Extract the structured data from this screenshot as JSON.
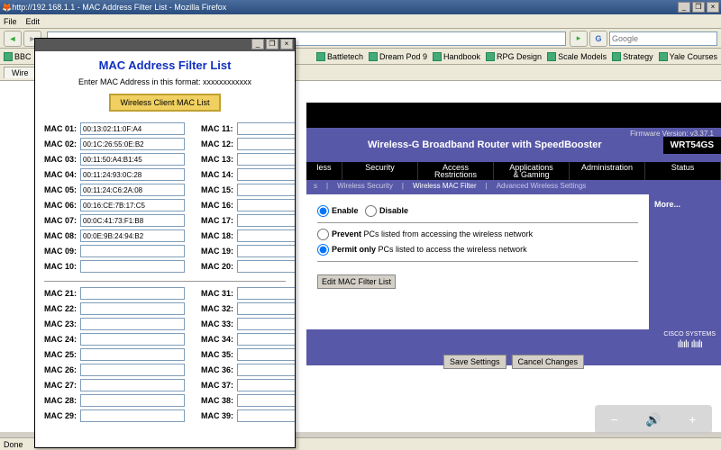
{
  "window": {
    "title": "http://192.168.1.1 - MAC Address Filter List - Mozilla Firefox"
  },
  "menu": {
    "file": "File",
    "edit": "Edit"
  },
  "search": {
    "placeholder": "Google"
  },
  "bookmarks": [
    "BBC",
    "Battletech",
    "Dream Pod 9",
    "Handbook",
    "RPG Design",
    "Scale Models",
    "Strategy",
    "Yale Courses"
  ],
  "tab": {
    "label": "Wire"
  },
  "router": {
    "fw": "Firmware Version: v3.37.1",
    "title": "Wireless-G Broadband Router with SpeedBooster",
    "model": "WRT54GS",
    "nav": {
      "less": "less",
      "security": "Security",
      "access": "Access\nRestrictions",
      "apps": "Applications\n& Gaming",
      "admin": "Administration",
      "status": "Status"
    },
    "subnav": {
      "s1": "s",
      "s2": "Wireless Security",
      "s3": "Wireless MAC Filter",
      "s4": "Advanced Wireless Settings"
    },
    "opt": {
      "enable": "Enable",
      "disable": "Disable",
      "prevent": "Prevent PCs listed from accessing the wireless network",
      "permit": "Permit only PCs listed to access the wireless network",
      "edit": "Edit MAC Filter List"
    },
    "more": "More...",
    "save": "Save Settings",
    "cancel": "Cancel Changes",
    "cisco": "CISCO SYSTEMS"
  },
  "popup": {
    "heading": "MAC Address Filter List",
    "hint": "Enter MAC Address in this format: xxxxxxxxxxxx",
    "btn": "Wireless Client MAC List",
    "left1": [
      {
        "l": "MAC 01:",
        "v": "00:13:02:11:0F:A4"
      },
      {
        "l": "MAC 02:",
        "v": "00:1C:26:55:0E:B2"
      },
      {
        "l": "MAC 03:",
        "v": "00:11:50:A4:B1:45"
      },
      {
        "l": "MAC 04:",
        "v": "00:11:24:93:0C:28"
      },
      {
        "l": "MAC 05:",
        "v": "00:11:24:C6:2A:08"
      },
      {
        "l": "MAC 06:",
        "v": "00:16:CE:7B:17:C5"
      },
      {
        "l": "MAC 07:",
        "v": "00:0C:41:73:F1:B8"
      },
      {
        "l": "MAC 08:",
        "v": "00:0E:9B:24:94:B2"
      },
      {
        "l": "MAC 09:",
        "v": ""
      },
      {
        "l": "MAC 10:",
        "v": ""
      }
    ],
    "right1": [
      {
        "l": "MAC 11:",
        "v": ""
      },
      {
        "l": "MAC 12:",
        "v": ""
      },
      {
        "l": "MAC 13:",
        "v": ""
      },
      {
        "l": "MAC 14:",
        "v": ""
      },
      {
        "l": "MAC 15:",
        "v": ""
      },
      {
        "l": "MAC 16:",
        "v": ""
      },
      {
        "l": "MAC 17:",
        "v": ""
      },
      {
        "l": "MAC 18:",
        "v": ""
      },
      {
        "l": "MAC 19:",
        "v": ""
      },
      {
        "l": "MAC 20:",
        "v": ""
      }
    ],
    "left2": [
      {
        "l": "MAC 21:",
        "v": ""
      },
      {
        "l": "MAC 22:",
        "v": ""
      },
      {
        "l": "MAC 23:",
        "v": ""
      },
      {
        "l": "MAC 24:",
        "v": ""
      },
      {
        "l": "MAC 25:",
        "v": ""
      },
      {
        "l": "MAC 26:",
        "v": ""
      },
      {
        "l": "MAC 27:",
        "v": ""
      },
      {
        "l": "MAC 28:",
        "v": ""
      },
      {
        "l": "MAC 29:",
        "v": ""
      }
    ],
    "right2": [
      {
        "l": "MAC 31:",
        "v": ""
      },
      {
        "l": "MAC 32:",
        "v": ""
      },
      {
        "l": "MAC 33:",
        "v": ""
      },
      {
        "l": "MAC 34:",
        "v": ""
      },
      {
        "l": "MAC 35:",
        "v": ""
      },
      {
        "l": "MAC 36:",
        "v": ""
      },
      {
        "l": "MAC 37:",
        "v": ""
      },
      {
        "l": "MAC 38:",
        "v": ""
      },
      {
        "l": "MAC 39:",
        "v": ""
      }
    ]
  },
  "status": {
    "done": "Done"
  }
}
